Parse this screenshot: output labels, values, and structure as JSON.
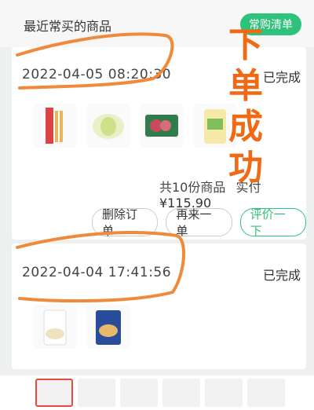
{
  "header": {
    "title": "最近常买的商品",
    "list_button": "常购清单"
  },
  "orders": [
    {
      "datetime": "2022-04-05 08:20:30",
      "status": "已完成",
      "count_text": "共10份商品",
      "paid_label": "实付",
      "price": "¥115.90",
      "items": [
        "spaghetti-icon",
        "cabbage-icon",
        "meat-pack-icon",
        "rice-bag-icon"
      ]
    },
    {
      "datetime": "2022-04-04 17:41:56",
      "status": "已完成",
      "items": [
        "flour-bag-icon",
        "noodle-pack-icon"
      ]
    }
  ],
  "actions": {
    "delete": "删除订单",
    "reorder": "再来一单",
    "review": "评价一下"
  },
  "overlay_text": [
    "下",
    "单",
    "成",
    "功"
  ],
  "colors": {
    "accent": "#2ec27a",
    "annotation": "#f06a16"
  }
}
